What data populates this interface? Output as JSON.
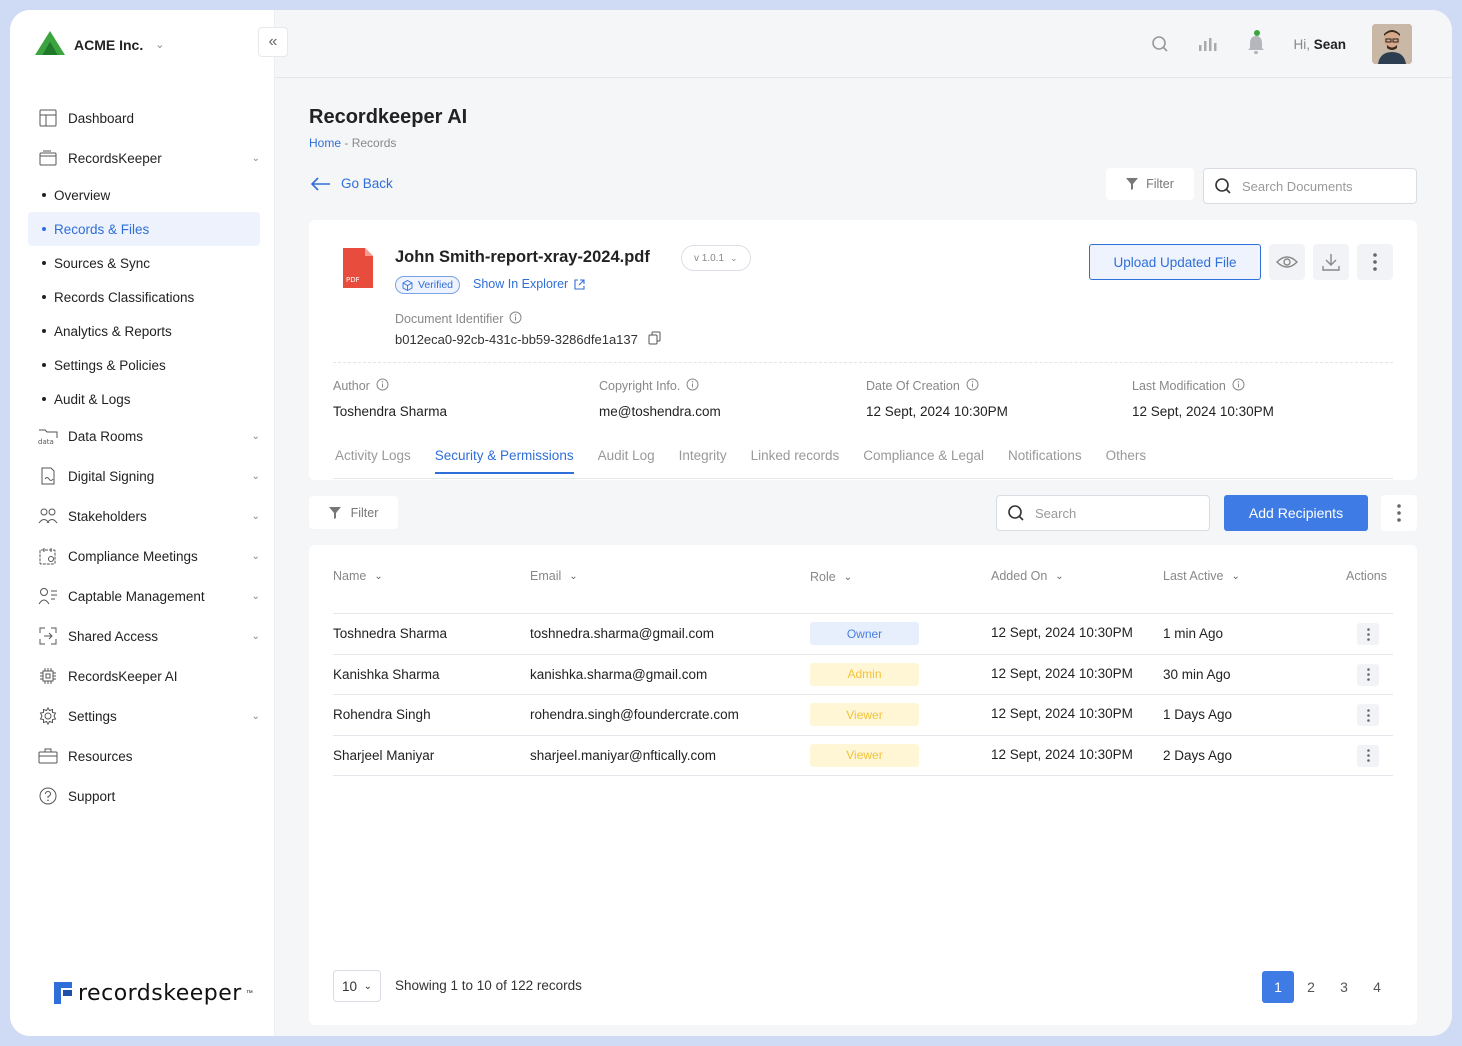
{
  "brand": {
    "name": "ACME Inc."
  },
  "sidebar": {
    "items": [
      {
        "key": "dashboard",
        "label": "Dashboard",
        "icon": "dashboard-icon",
        "chevron": false
      },
      {
        "key": "recordskeeper",
        "label": "RecordsKeeper",
        "icon": "folder-icon",
        "chevron": true
      },
      {
        "key": "data-rooms",
        "label": "Data Rooms",
        "icon": "data-folder-icon",
        "chevron": true
      },
      {
        "key": "digital-signing",
        "label": "Digital Signing",
        "icon": "signature-icon",
        "chevron": true
      },
      {
        "key": "stakeholders",
        "label": "Stakeholders",
        "icon": "users-icon",
        "chevron": true
      },
      {
        "key": "compliance-meetings",
        "label": "Compliance Meetings",
        "icon": "calendar-icon",
        "chevron": true
      },
      {
        "key": "captable",
        "label": "Captable Management",
        "icon": "user-list-icon",
        "chevron": true
      },
      {
        "key": "shared-access",
        "label": "Shared Access",
        "icon": "share-icon",
        "chevron": true
      },
      {
        "key": "recordskeeper-ai",
        "label": "RecordsKeeper AI",
        "icon": "chip-icon",
        "chevron": false
      },
      {
        "key": "settings",
        "label": "Settings",
        "icon": "gear-icon",
        "chevron": true
      },
      {
        "key": "resources",
        "label": "Resources",
        "icon": "briefcase-icon",
        "chevron": false
      },
      {
        "key": "support",
        "label": "Support",
        "icon": "help-icon",
        "chevron": false
      }
    ],
    "subitems": [
      {
        "label": "Overview",
        "active": false
      },
      {
        "label": "Records & Files",
        "active": true
      },
      {
        "label": "Sources & Sync",
        "active": false
      },
      {
        "label": "Records Classifications",
        "active": false
      },
      {
        "label": "Analytics & Reports",
        "active": false
      },
      {
        "label": "Settings & Policies",
        "active": false
      },
      {
        "label": "Audit & Logs",
        "active": false
      }
    ],
    "footer_logo": "recordskeeper"
  },
  "topbar": {
    "greeting": "Hi,",
    "user": "Sean"
  },
  "page": {
    "title": "Recordkeeper AI",
    "breadcrumb_home": "Home",
    "breadcrumb_sep": " - ",
    "breadcrumb_current": "Records",
    "go_back": "Go Back",
    "filter_label": "Filter",
    "search_placeholder": "Search Documents"
  },
  "document": {
    "file_type": "PDF",
    "name": "John Smith-report-xray-2024.pdf",
    "version": "v 1.0.1",
    "verified": "Verified",
    "explorer": "Show In Explorer",
    "id_label": "Document Identifier",
    "id_value": "b012eca0-92cb-431c-bb59-3286dfe1a137",
    "upload_label": "Upload Updated File",
    "meta": [
      {
        "label": "Author",
        "value": "Toshendra Sharma"
      },
      {
        "label": "Copyright Info.",
        "value": "me@toshendra.com"
      },
      {
        "label": "Date Of Creation",
        "value": "12 Sept, 2024 10:30PM"
      },
      {
        "label": "Last Modification",
        "value": "12 Sept, 2024 10:30PM"
      }
    ],
    "tabs": [
      {
        "label": "Activity Logs",
        "active": false
      },
      {
        "label": "Security & Permissions",
        "active": true
      },
      {
        "label": "Audit Log",
        "active": false
      },
      {
        "label": "Integrity",
        "active": false
      },
      {
        "label": "Linked records",
        "active": false
      },
      {
        "label": "Compliance & Legal",
        "active": false
      },
      {
        "label": "Notifications",
        "active": false
      },
      {
        "label": "Others",
        "active": false
      }
    ]
  },
  "toolbar": {
    "filter_label": "Filter",
    "search_placeholder": "Search",
    "add_label": "Add Recipients"
  },
  "table": {
    "columns": [
      "Name",
      "Email",
      "Role",
      "Added On",
      "Last Active",
      "Actions"
    ],
    "rows": [
      {
        "name": "Toshnedra Sharma",
        "email": "toshnedra.sharma@gmail.com",
        "role": "Owner",
        "added": "12 Sept, 2024 10:30PM",
        "active": "1 min Ago"
      },
      {
        "name": "Kanishka Sharma",
        "email": "kanishka.sharma@gmail.com",
        "role": "Admin",
        "added": "12 Sept, 2024 10:30PM",
        "active": "30 min Ago"
      },
      {
        "name": "Rohendra Singh",
        "email": "rohendra.singh@foundercrate.com",
        "role": "Viewer",
        "added": "12 Sept, 2024 10:30PM",
        "active": "1 Days Ago"
      },
      {
        "name": "Sharjeel Maniyar",
        "email": "sharjeel.maniyar@nftically.com",
        "role": "Viewer",
        "added": "12 Sept, 2024 10:30PM",
        "active": "2 Days Ago"
      }
    ]
  },
  "pagination": {
    "page_size": "10",
    "showing": "Showing 1 to 10 of 122 records",
    "pages": [
      "1",
      "2",
      "3",
      "4"
    ],
    "current": "1"
  },
  "colors": {
    "accent": "#3e7be4",
    "owner_bg": "#e7eefc",
    "admin_bg": "#fff6d6"
  }
}
